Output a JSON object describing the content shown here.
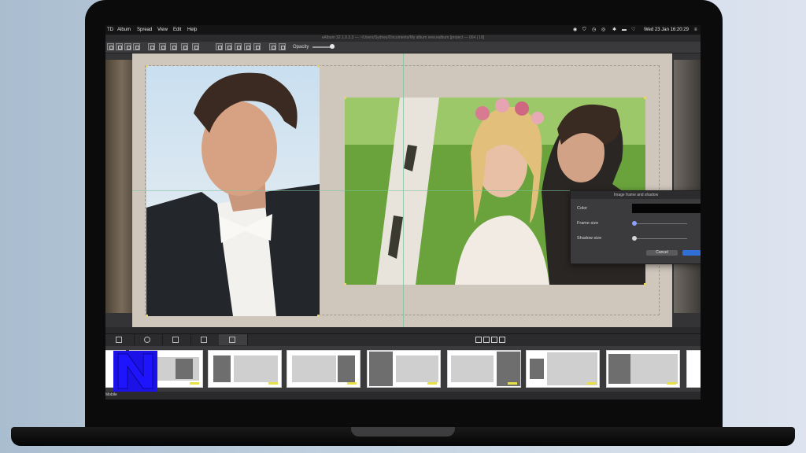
{
  "menubar": {
    "app_abbrev": "TD",
    "menus": [
      "Album",
      "Spread",
      "View",
      "Edit",
      "Help"
    ],
    "clock": "Wed 23 Jan  16:20:29"
  },
  "window_title": "eAlbum 32.1.0.3.3 — ~/Users/Sydney/Documents/My album new.ealbum [project — 004 | 18]",
  "toolbar": {
    "opacity_label": "Opacity"
  },
  "dialog": {
    "title": "Image frame and shadow",
    "color_label": "Color",
    "frame_size_label": "Frame size",
    "shadow_size_label": "Shadow size",
    "cancel_label": "Cancel"
  },
  "footer": {
    "label": "Mobile"
  },
  "colors": {
    "accent_blue": "#2f6fd6",
    "logo_blue": "#1c12e8",
    "page_bg": "#cfc7bc",
    "guide_green": "#7cc4a0"
  }
}
